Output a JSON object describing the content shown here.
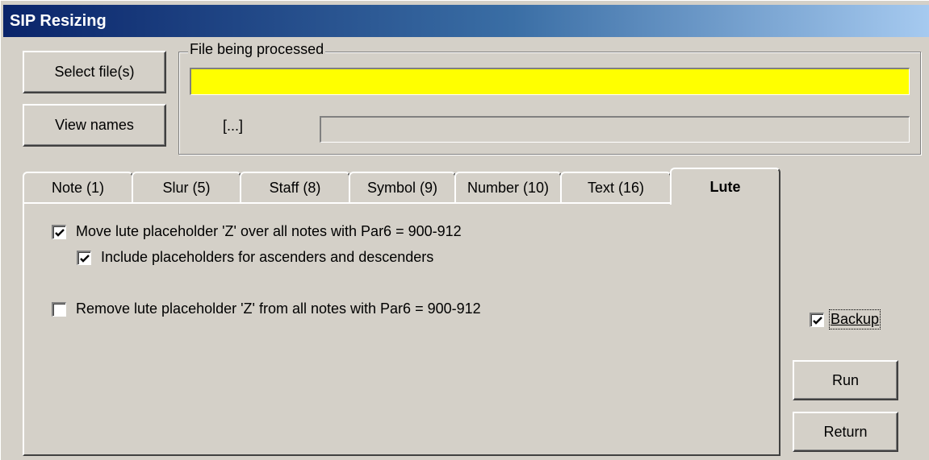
{
  "window": {
    "title": "SIP Resizing"
  },
  "buttons": {
    "select_files": "Select file(s)",
    "view_names": "View names",
    "run": "Run",
    "return": "Return"
  },
  "file_group": {
    "label": "File being processed",
    "current_file": "",
    "counter_text": "[...]",
    "progress": 0
  },
  "tabs": [
    {
      "label": "Note (1)",
      "active": false
    },
    {
      "label": "Slur (5)",
      "active": false
    },
    {
      "label": "Staff (8)",
      "active": false
    },
    {
      "label": "Symbol (9)",
      "active": false
    },
    {
      "label": "Number (10)",
      "active": false
    },
    {
      "label": "Text (16)",
      "active": false
    },
    {
      "label": "Lute",
      "active": true
    }
  ],
  "lute_panel": {
    "move_placeholder": {
      "label": "Move lute placeholder 'Z' over all notes with Par6 = 900-912",
      "checked": true
    },
    "include_placeholders": {
      "label": "Include placeholders for ascenders and descenders",
      "checked": true
    },
    "remove_placeholder": {
      "label": "Remove lute placeholder 'Z' from all notes with Par6 = 900-912",
      "checked": false
    }
  },
  "backup": {
    "label": "Backup",
    "checked": true
  },
  "colors": {
    "title_gradient_start": "#0a246a",
    "title_gradient_end": "#a6caf0",
    "file_highlight": "#ffff00",
    "window_face": "#d4d0c8"
  }
}
